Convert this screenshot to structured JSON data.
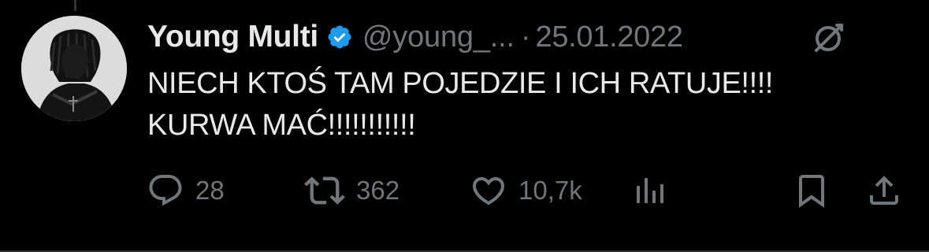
{
  "tweet": {
    "display_name": "Young Multi",
    "handle": "@young_...",
    "separator": "·",
    "date": "25.01.2022",
    "text_lines": [
      "NIECH KTOŚ TAM POJEDZIE I ICH RATUJE!!!!",
      "KURWA MAĆ!!!!!!!!!!!"
    ]
  },
  "actions": {
    "replies": "28",
    "retweets": "362",
    "likes": "10,7k"
  },
  "icons": {
    "verified": "verified-badge-icon",
    "grok": "grok-icon",
    "reply": "reply-icon",
    "retweet": "retweet-icon",
    "like": "heart-icon",
    "views": "views-icon",
    "bookmark": "bookmark-icon",
    "share": "share-icon"
  },
  "colors": {
    "background": "#000000",
    "text": "#e7e9ea",
    "muted": "#71767b",
    "verified": "#1d9bf0"
  }
}
